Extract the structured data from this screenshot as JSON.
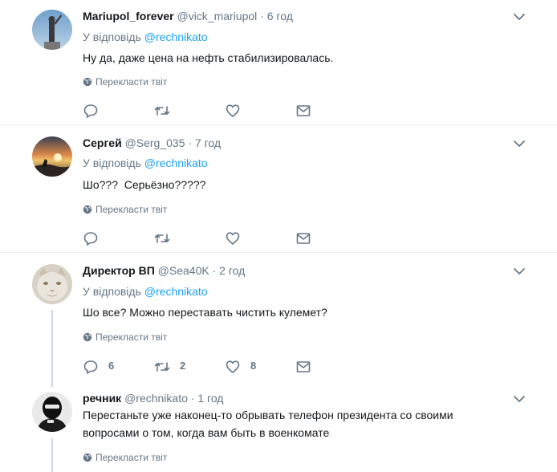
{
  "translate_label": "Перекласти твіт",
  "reply_prefix": "У відповідь",
  "colors": {
    "link": "#1da1f2",
    "muted": "#657786",
    "divider": "#e6ecf0",
    "text": "#14171a"
  },
  "tweets": [
    {
      "name": "Mariupol_forever",
      "handle": "@vick_mariupol",
      "time": "6 год",
      "reply_to": "@rechnikato",
      "text": "Ну да, даже цена на нефть стабилизировалась.",
      "counts": {
        "reply": "",
        "retweet": "",
        "like": ""
      }
    },
    {
      "name": "Сергей",
      "handle": "@Serg_035",
      "time": "7 год",
      "reply_to": "@rechnikato",
      "text": "Шо???  Серьёзно?????",
      "counts": {
        "reply": "",
        "retweet": "",
        "like": ""
      }
    },
    {
      "name": "Директор ВП",
      "handle": "@Sea40K",
      "time": "2 год",
      "reply_to": "@rechnikato",
      "text": "Шо все? Можно переставать чистить кулемет?",
      "counts": {
        "reply": "6",
        "retweet": "2",
        "like": "8"
      }
    },
    {
      "name": "речник",
      "handle": "@rechnikato",
      "time": "1 год",
      "text_line1": "Перестаньте уже наконец-то обрывать телефон президента со своими",
      "text_line2": "вопросами о том, когда вам быть в военкомате"
    }
  ]
}
